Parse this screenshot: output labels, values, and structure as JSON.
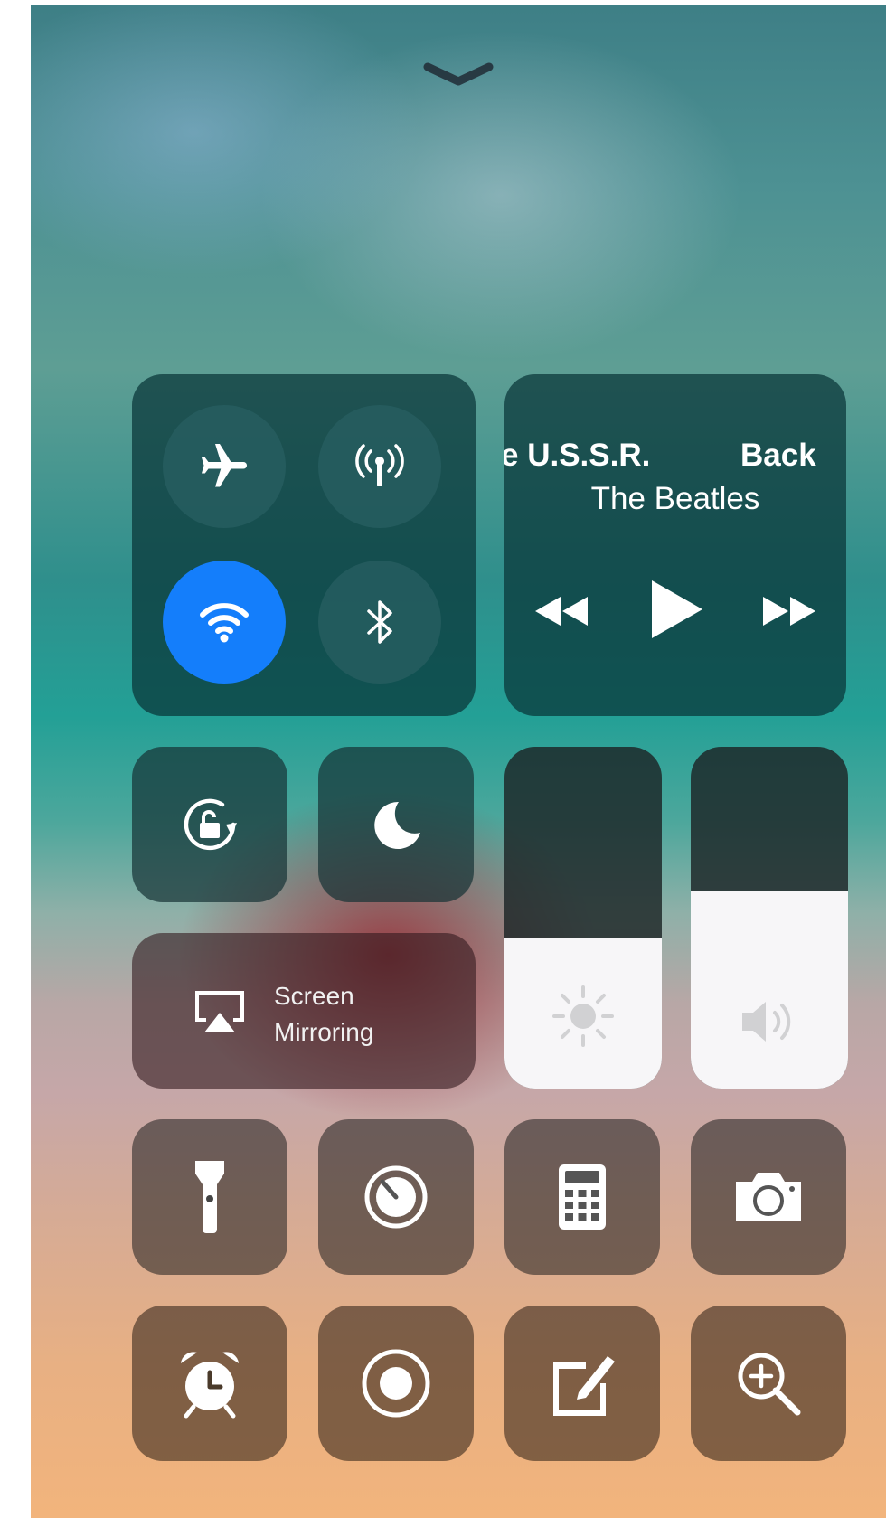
{
  "control_center": {
    "dismiss_icon": "chevron-down-icon",
    "connectivity": {
      "airplane": {
        "icon": "airplane-icon",
        "active": false
      },
      "cellular": {
        "icon": "antenna-icon",
        "active": false
      },
      "wifi": {
        "icon": "wifi-icon",
        "active": true,
        "color": "#147efb"
      },
      "bluetooth": {
        "icon": "bluetooth-icon",
        "active": false
      }
    },
    "now_playing": {
      "title_left": "e U.S.S.R.",
      "title_right": "Back",
      "artist": "The Beatles",
      "controls": [
        "rewind-icon",
        "play-icon",
        "fast-forward-icon"
      ]
    },
    "orientation_lock": {
      "icon": "rotation-lock-icon"
    },
    "do_not_disturb": {
      "icon": "moon-icon"
    },
    "screen_mirroring": {
      "label_line1": "Screen",
      "label_line2": "Mirroring",
      "icon": "airplay-icon"
    },
    "brightness": {
      "icon": "sun-icon",
      "level_percent": 44
    },
    "volume": {
      "icon": "speaker-icon",
      "level_percent": 58
    },
    "shortcuts_row1": [
      "flashlight-icon",
      "timer-icon",
      "calculator-icon",
      "camera-icon"
    ],
    "shortcuts_row2": [
      "alarm-icon",
      "screen-record-icon",
      "notes-icon",
      "magnifier-icon"
    ]
  }
}
